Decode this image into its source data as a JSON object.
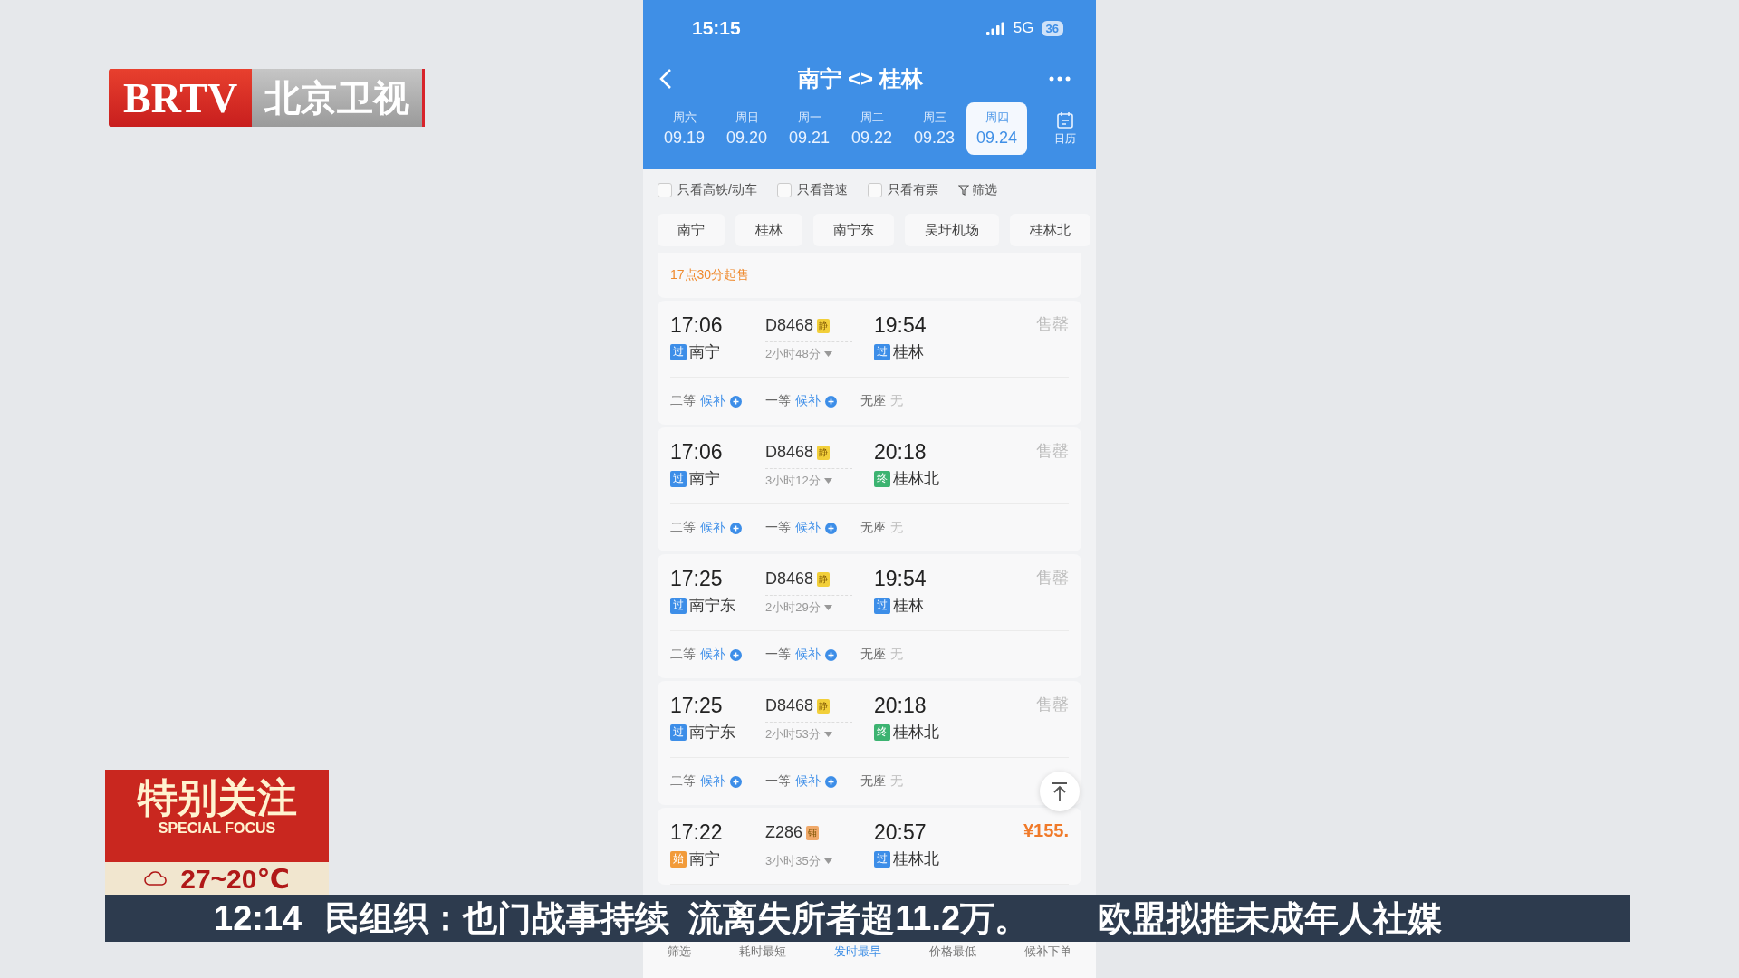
{
  "status_bar": {
    "time": "15:15",
    "network": "5G",
    "battery": "36"
  },
  "header": {
    "title": "南宁 <> 桂林",
    "calendar_label": "日历",
    "dates": [
      {
        "weekday": "周六",
        "date": "09.19",
        "selected": false
      },
      {
        "weekday": "周日",
        "date": "09.20",
        "selected": false
      },
      {
        "weekday": "周一",
        "date": "09.21",
        "selected": false
      },
      {
        "weekday": "周二",
        "date": "09.22",
        "selected": false
      },
      {
        "weekday": "周三",
        "date": "09.23",
        "selected": false
      },
      {
        "weekday": "周四",
        "date": "09.24",
        "selected": true
      }
    ]
  },
  "filters": [
    {
      "label": "只看高铁/动车",
      "checked": false
    },
    {
      "label": "只看普速",
      "checked": false
    },
    {
      "label": "只看有票",
      "checked": false
    }
  ],
  "filter_button": "筛选",
  "stations": [
    "南宁",
    "桂林",
    "南宁东",
    "吴圩机场",
    "桂林北"
  ],
  "sale_notice": "17点30分起售",
  "trains": [
    {
      "depart": "17:06",
      "from": "南宁",
      "from_tag": {
        "text": "过",
        "kind": "pass"
      },
      "number": "D8468",
      "badge": {
        "text": "静",
        "kind": "quiet"
      },
      "duration": "2小时48分",
      "arrive": "19:54",
      "to": "桂林",
      "to_tag": {
        "text": "过",
        "kind": "pass"
      },
      "status": {
        "text": "售罄",
        "kind": "soldout"
      },
      "seats": [
        {
          "class": "二等",
          "value": "候补",
          "kind": "waitlist"
        },
        {
          "class": "一等",
          "value": "候补",
          "kind": "waitlist"
        },
        {
          "class": "无座",
          "value": "无",
          "kind": "none"
        }
      ]
    },
    {
      "depart": "17:06",
      "from": "南宁",
      "from_tag": {
        "text": "过",
        "kind": "pass"
      },
      "number": "D8468",
      "badge": {
        "text": "静",
        "kind": "quiet"
      },
      "duration": "3小时12分",
      "arrive": "20:18",
      "to": "桂林北",
      "to_tag": {
        "text": "终",
        "kind": "end"
      },
      "status": {
        "text": "售罄",
        "kind": "soldout"
      },
      "seats": [
        {
          "class": "二等",
          "value": "候补",
          "kind": "waitlist"
        },
        {
          "class": "一等",
          "value": "候补",
          "kind": "waitlist"
        },
        {
          "class": "无座",
          "value": "无",
          "kind": "none"
        }
      ]
    },
    {
      "depart": "17:25",
      "from": "南宁东",
      "from_tag": {
        "text": "过",
        "kind": "pass"
      },
      "number": "D8468",
      "badge": {
        "text": "静",
        "kind": "quiet"
      },
      "duration": "2小时29分",
      "arrive": "19:54",
      "to": "桂林",
      "to_tag": {
        "text": "过",
        "kind": "pass"
      },
      "status": {
        "text": "售罄",
        "kind": "soldout"
      },
      "seats": [
        {
          "class": "二等",
          "value": "候补",
          "kind": "waitlist"
        },
        {
          "class": "一等",
          "value": "候补",
          "kind": "waitlist"
        },
        {
          "class": "无座",
          "value": "无",
          "kind": "none"
        }
      ]
    },
    {
      "depart": "17:25",
      "from": "南宁东",
      "from_tag": {
        "text": "过",
        "kind": "pass"
      },
      "number": "D8468",
      "badge": {
        "text": "静",
        "kind": "quiet"
      },
      "duration": "2小时53分",
      "arrive": "20:18",
      "to": "桂林北",
      "to_tag": {
        "text": "终",
        "kind": "end"
      },
      "status": {
        "text": "售罄",
        "kind": "soldout"
      },
      "seats": [
        {
          "class": "二等",
          "value": "候补",
          "kind": "waitlist"
        },
        {
          "class": "一等",
          "value": "候补",
          "kind": "waitlist"
        },
        {
          "class": "无座",
          "value": "无",
          "kind": "none"
        }
      ]
    },
    {
      "depart": "17:22",
      "from": "南宁",
      "from_tag": {
        "text": "始",
        "kind": "start"
      },
      "number": "Z286",
      "badge": {
        "text": "铺",
        "kind": "berth"
      },
      "duration": "3小时35分",
      "arrive": "20:57",
      "to": "桂林北",
      "to_tag": {
        "text": "过",
        "kind": "pass"
      },
      "status": {
        "text": "¥155.",
        "kind": "price"
      }
    }
  ],
  "bottom_tabs": [
    {
      "label": "筛选",
      "selected": false
    },
    {
      "label": "耗时最短",
      "selected": false
    },
    {
      "label": "发时最早",
      "selected": true
    },
    {
      "label": "价格最低",
      "selected": false
    },
    {
      "label": "候补下单",
      "selected": false
    }
  ],
  "broadcast": {
    "logo": {
      "latin": "BRTV",
      "name": "北京卫视"
    },
    "special": {
      "title": "特别关注",
      "subtitle": "SPECIAL FOCUS",
      "weather": "27~20℃"
    },
    "ticker": {
      "time": "12:14",
      "items": [
        "民组织：也门战事持续  流离失所者超11.2万。",
        "欧盟拟推未成年人社媒"
      ]
    }
  }
}
